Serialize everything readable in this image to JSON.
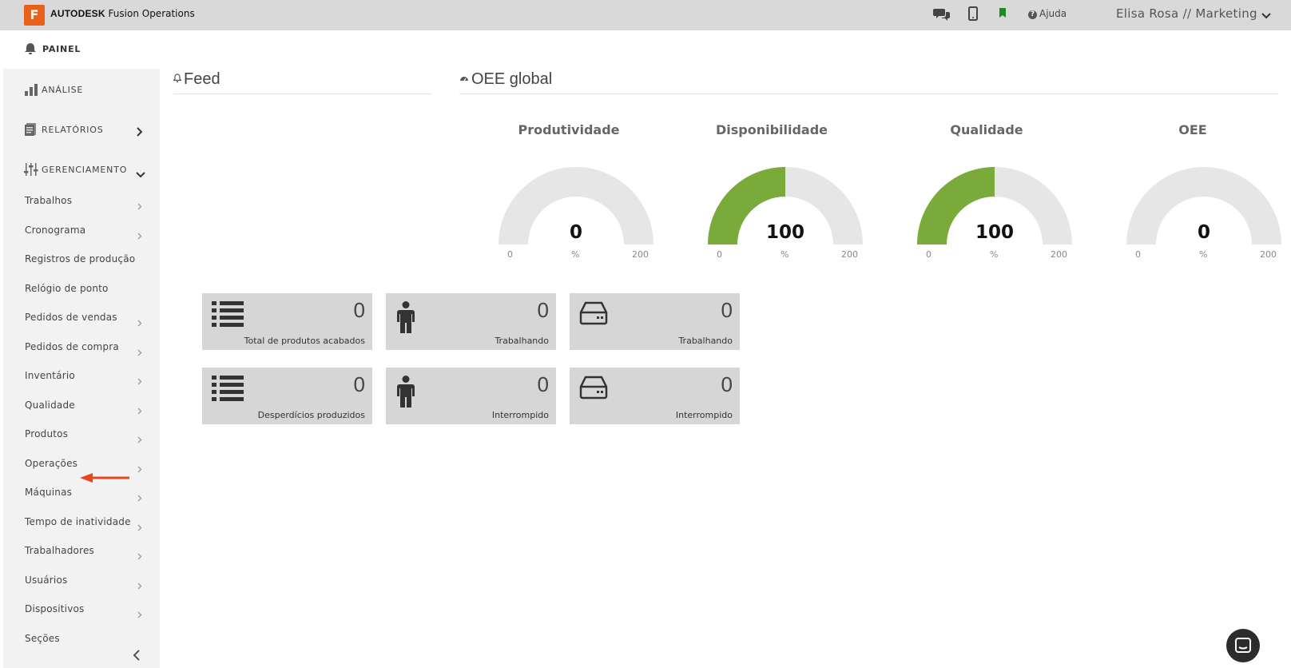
{
  "topbar": {
    "logo_letter": "F",
    "brand_bold": "AUTODESK",
    "brand_rest": " Fusion Operations",
    "help_label": "Ajuda",
    "user_label": "Elisa Rosa // Marketing"
  },
  "painel": {
    "label": "PAINEL"
  },
  "sidebar": {
    "sections": [
      {
        "label": "ANÁLISE"
      },
      {
        "label": "RELATÓRIOS"
      },
      {
        "label": "GERENCIAMENTO"
      }
    ],
    "items": [
      {
        "label": "Trabalhos"
      },
      {
        "label": "Cronograma"
      },
      {
        "label": "Registros de produção"
      },
      {
        "label": "Relógio de ponto"
      },
      {
        "label": "Pedidos de vendas"
      },
      {
        "label": "Pedidos de compra"
      },
      {
        "label": "Inventário"
      },
      {
        "label": "Qualidade"
      },
      {
        "label": "Produtos"
      },
      {
        "label": "Operações"
      },
      {
        "label": "Máquinas"
      },
      {
        "label": "Tempo de inatividade"
      },
      {
        "label": "Trabalhadores"
      },
      {
        "label": "Usuários"
      },
      {
        "label": "Dispositivos"
      },
      {
        "label": "Seções"
      }
    ]
  },
  "feed": {
    "title": "Feed"
  },
  "oee": {
    "title": "OEE global",
    "gauges": [
      {
        "title": "Produtividade",
        "value": "0",
        "fraction": 0,
        "min": "0",
        "max": "200",
        "unit": "%"
      },
      {
        "title": "Disponibilidade",
        "value": "100",
        "fraction": 0.5,
        "min": "0",
        "max": "200",
        "unit": "%"
      },
      {
        "title": "Qualidade",
        "value": "100",
        "fraction": 0.5,
        "min": "0",
        "max": "200",
        "unit": "%"
      },
      {
        "title": "OEE",
        "value": "0",
        "fraction": 0,
        "min": "0",
        "max": "200",
        "unit": "%"
      }
    ]
  },
  "tiles": [
    {
      "value": "0",
      "caption": "Total de produtos acabados",
      "icon": "list-icon"
    },
    {
      "value": "0",
      "caption": "Trabalhando",
      "icon": "person-icon"
    },
    {
      "value": "0",
      "caption": "Trabalhando",
      "icon": "machine-icon"
    },
    {
      "value": "0",
      "caption": "Desperdícios produzidos",
      "icon": "list-icon"
    },
    {
      "value": "0",
      "caption": "Interrompido",
      "icon": "person-icon"
    },
    {
      "value": "0",
      "caption": "Interrompido",
      "icon": "machine-icon"
    }
  ],
  "colors": {
    "gauge_fill": "#7aab3a",
    "gauge_track": "#e6e6e6",
    "accent": "#e8611a",
    "annotation_arrow": "#e8461c"
  }
}
